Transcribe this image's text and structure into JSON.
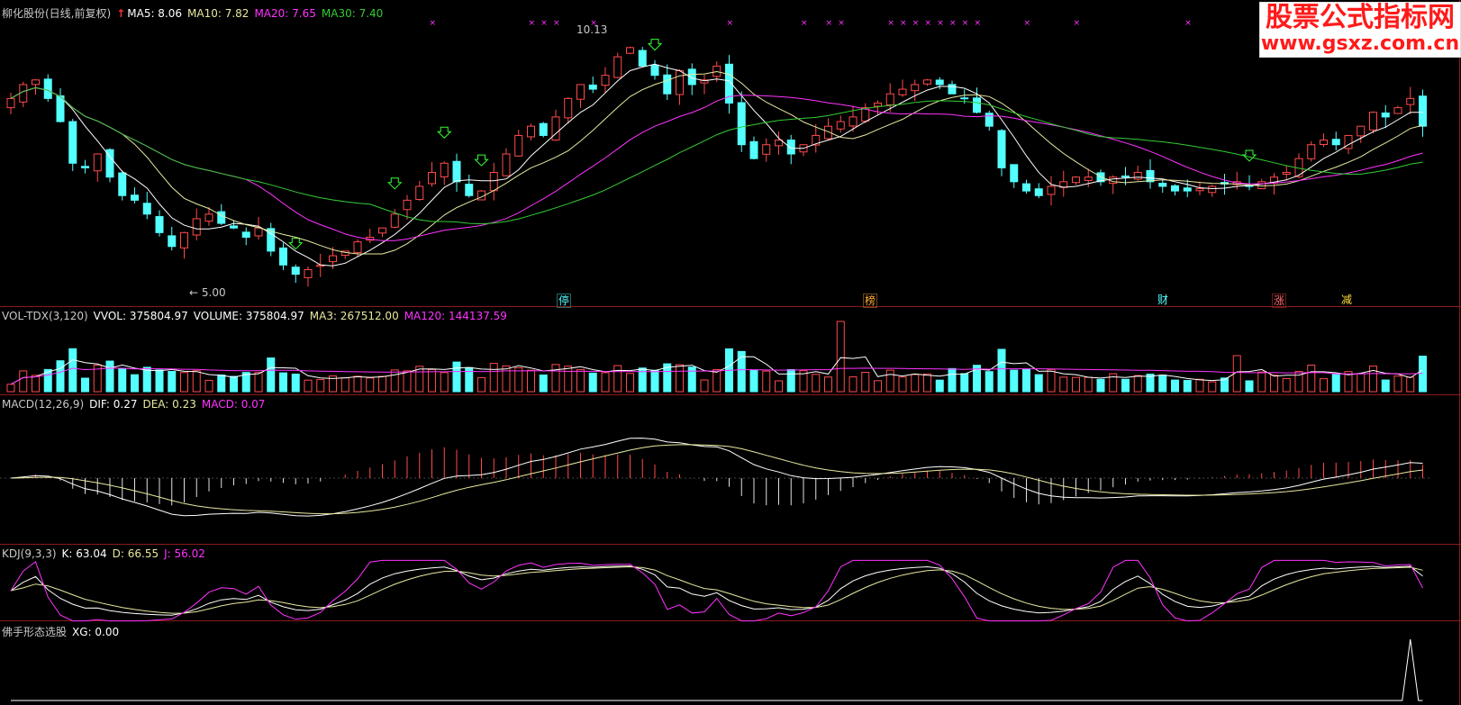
{
  "main_panel": {
    "title": "柳化股份(日线,前复权)",
    "arrow": "↑",
    "ma5": "MA5: 8.06",
    "ma10": "MA10: 7.82",
    "ma20": "MA20: 7.65",
    "ma30": "MA30: 7.40",
    "high_label": "10.13",
    "low_label": "← 5.00",
    "signals": [
      "停",
      "榜",
      "财",
      "涨",
      "减"
    ]
  },
  "vol_panel": {
    "name": "VOL-TDX(3,120)",
    "vvol": "VVOL: 375804.97",
    "volume": "VOLUME: 375804.97",
    "ma3": "MA3: 267512.00",
    "ma120": "MA120: 144137.59"
  },
  "macd_panel": {
    "name": "MACD(12,26,9)",
    "dif": "DIF: 0.27",
    "dea": "DEA: 0.23",
    "macd": "MACD: 0.07"
  },
  "kdj_panel": {
    "name": "KDJ(9,3,3)",
    "k": "K: 63.04",
    "d": "D: 66.55",
    "j": "J: 56.02"
  },
  "xg_panel": {
    "name": "佛手形态选股",
    "xg": "XG: 0.00"
  },
  "watermark": {
    "title": "股票公式指标网",
    "url": "www.gsxz.com.cn"
  },
  "colors": {
    "up": "#ff4a4a",
    "down": "#54ffff",
    "ma5": "#ffffff",
    "ma10": "#e8e8a0",
    "ma20": "#ff33ff",
    "ma30": "#33cc33",
    "divider": "#8b1a1a",
    "arrow_green": "#33ff33",
    "marker": "#ff33ff"
  },
  "chart_data": {
    "type": "candlestick",
    "close": [
      8.9,
      9.2,
      9.3,
      8.9,
      8.4,
      7.5,
      7.4,
      7.7,
      7.2,
      6.8,
      6.7,
      6.4,
      6.0,
      5.7,
      6.0,
      6.3,
      6.4,
      6.2,
      6.1,
      5.9,
      6.1,
      5.6,
      5.3,
      5.1,
      5.2,
      5.3,
      5.5,
      5.6,
      5.8,
      5.9,
      6.1,
      6.4,
      6.7,
      7.0,
      7.3,
      7.5,
      7.1,
      6.8,
      6.9,
      7.3,
      7.7,
      8.1,
      8.3,
      8.1,
      8.5,
      8.9,
      9.2,
      9.1,
      9.4,
      9.8,
      10.0,
      9.6,
      9.4,
      9.0,
      9.5,
      9.2,
      9.3,
      9.6,
      8.8,
      7.9,
      7.6,
      7.9,
      8.0,
      7.7,
      7.9,
      8.1,
      8.3,
      8.4,
      8.5,
      8.7,
      8.8,
      9.0,
      9.1,
      9.2,
      9.3,
      9.2,
      9.0,
      8.9,
      8.6,
      8.3,
      7.4,
      7.1,
      6.9,
      6.8,
      7.0,
      7.1,
      7.2,
      7.2,
      7.1,
      7.2,
      7.2,
      7.3,
      7.1,
      7.0,
      6.9,
      6.9,
      6.95,
      7.0,
      7.05,
      7.1,
      7.0,
      7.1,
      7.2,
      7.3,
      7.6,
      7.9,
      8.0,
      7.9,
      8.1,
      8.3,
      8.6,
      8.5,
      8.7,
      8.9,
      8.3
    ],
    "xg_signal_index": 113,
    "xg_signal_value": 1
  }
}
